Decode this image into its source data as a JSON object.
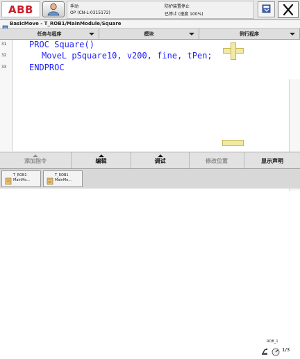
{
  "brand": {
    "logo": "ABB"
  },
  "status": {
    "mode": "手动",
    "controller": "OP (CN-L-0315172)",
    "safety": "防护装置停止",
    "run": "已停止 (速度 100%)"
  },
  "window": {
    "title": "BasicMove - T_ROB1/MainModule/Square"
  },
  "menu": {
    "items": [
      "任务与程序",
      "模块",
      "例行程序"
    ]
  },
  "editor": {
    "lines": [
      {
        "num": "31",
        "text": "PROC Square()"
      },
      {
        "num": "32",
        "text": "MoveL pSquare10, v200, fine, tPen;"
      },
      {
        "num": "33",
        "text": "ENDPROC"
      }
    ]
  },
  "toolbar": {
    "buttons": [
      {
        "label": "添加指令",
        "enabled": false
      },
      {
        "label": "编辑",
        "enabled": true
      },
      {
        "label": "调试",
        "enabled": true
      },
      {
        "label": "修改位置",
        "enabled": false
      },
      {
        "label": "显示声明",
        "enabled": true
      }
    ]
  },
  "taskbar": {
    "tasks": [
      {
        "line1": "T_ROB1",
        "line2": "MainMo..."
      },
      {
        "line1": "T_ROB1",
        "line2": "MainMo..."
      }
    ],
    "rob": {
      "label": "ROB_1",
      "speed": "1/3"
    }
  },
  "colors": {
    "logo_red": "#cc1f2b",
    "code_blue": "#1f1fff",
    "zoom_fill": "#f2e9a4"
  },
  "icons": {
    "user": "user-icon",
    "task_window": "window-icon",
    "close": "close-icon",
    "zoom_in": "plus-icon",
    "zoom_out": "minus-icon"
  }
}
